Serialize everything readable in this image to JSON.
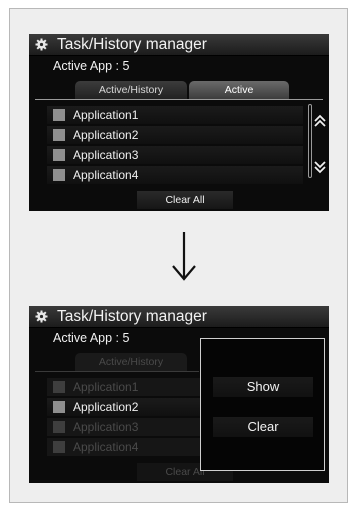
{
  "top_screen": {
    "title": "Task/History manager",
    "active_app": "Active App : 5",
    "tabs": [
      {
        "label": "Active/History",
        "selected": false
      },
      {
        "label": "Active",
        "selected": true
      }
    ],
    "applications": [
      "Application1",
      "Application2",
      "Application3",
      "Application4"
    ],
    "clear_all": "Clear All"
  },
  "bottom_screen": {
    "title": "Task/History manager",
    "active_app": "Active App : 5",
    "tabs": [
      {
        "label": "Active/History"
      }
    ],
    "applications": [
      "Application1",
      "Application2",
      "Application3",
      "Application4"
    ],
    "clear_all": "Clear All",
    "popup": {
      "show_label": "Show",
      "clear_label": "Clear"
    }
  },
  "icons": {
    "title_icon": "gear-icon",
    "scroll_up": "double-chevron-up-icon",
    "scroll_down": "double-chevron-down-icon",
    "transition": "arrow-down-icon"
  }
}
